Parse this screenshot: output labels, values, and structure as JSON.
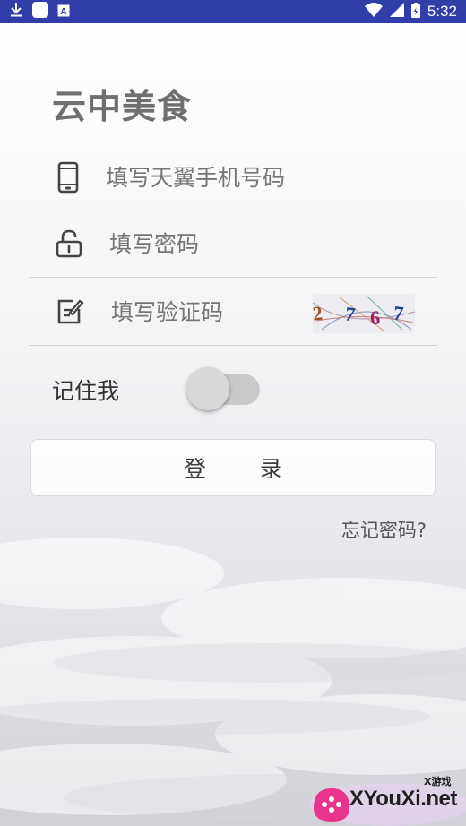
{
  "status_bar": {
    "time": "5:32",
    "icons": [
      "download-icon",
      "notification-square-icon",
      "app-a-icon",
      "wifi-icon",
      "signal-icon",
      "battery-icon"
    ],
    "bg_color": "#2f3ea8"
  },
  "app": {
    "title": "云中美食"
  },
  "form": {
    "phone": {
      "placeholder": "填写天翼手机号码",
      "icon": "phone-icon"
    },
    "password": {
      "placeholder": "填写密码",
      "icon": "unlock-icon"
    },
    "captcha": {
      "placeholder": "填写验证码",
      "icon": "edit-icon",
      "code": "2767"
    },
    "remember": {
      "label": "记住我",
      "checked": false
    },
    "login_label": "登 录",
    "forgot_label": "忘记密码?"
  },
  "watermark": {
    "brand": "XYouXi.net",
    "tag": "X游戏"
  }
}
